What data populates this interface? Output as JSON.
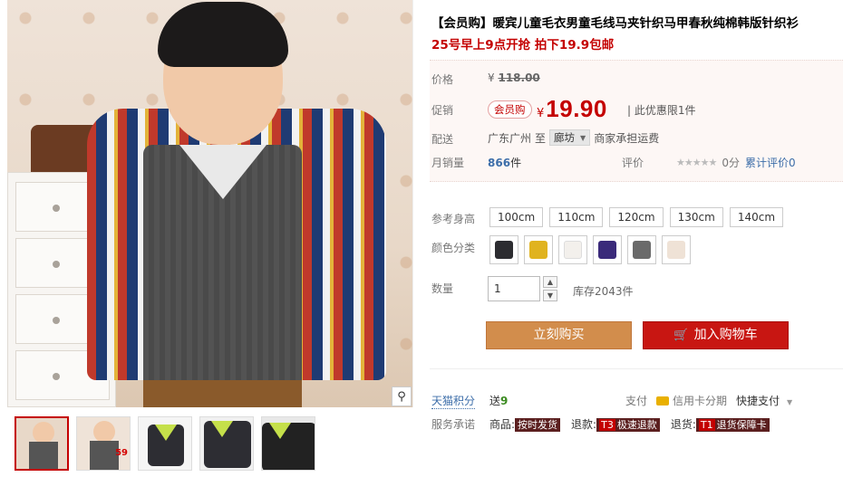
{
  "product": {
    "title": "【会员购】暖宾儿童毛衣男童毛线马夹针织马甲春秋纯棉韩版针织衫",
    "subtitle": "25号早上9点开抢 拍下19.9包邮"
  },
  "price": {
    "label": "价格",
    "currency": "¥",
    "original": "118.00"
  },
  "promo": {
    "label": "促销",
    "badge": "会员购",
    "currency": "¥",
    "value": "19.90",
    "limit": "| 此优惠限1件"
  },
  "delivery": {
    "label": "配送",
    "from": "广东广州",
    "to_word": "至",
    "dest": "廊坊",
    "freight": "商家承担运费"
  },
  "sales": {
    "label": "月销量",
    "count": "866",
    "unit": "件",
    "review_label": "评价",
    "stars": "★★★★★",
    "score": "0分",
    "review_link": "累计评价",
    "review_count": "0"
  },
  "sizes": {
    "label": "参考身高",
    "options": [
      "100cm",
      "110cm",
      "120cm",
      "130cm",
      "140cm"
    ]
  },
  "color": {
    "label": "颜色分类",
    "swatches": [
      "#2c2c30",
      "#e0b31f",
      "#f3f0ec",
      "#3a2a7a",
      "#6a6a6a",
      "#efe2d6"
    ]
  },
  "quantity": {
    "label": "数量",
    "value": "1",
    "stock": "库存2043件"
  },
  "actions": {
    "buy": "立刻购买",
    "cart": "加入购物车"
  },
  "points": {
    "label": "天猫积分",
    "prefix": "送",
    "value": "9"
  },
  "payment": {
    "label": "支付",
    "credit": "信用卡分期",
    "fast": "快捷支付"
  },
  "service": {
    "label": "服务承诺",
    "goods_label": "商品:",
    "goods_tag": "按时发货",
    "refund_label": "退款:",
    "refund_tag": "极速退款",
    "return_label": "退货:",
    "return_tag": "退货保障卡",
    "t3": "T3",
    "t1": "T1"
  },
  "gallery": {
    "thumb_price": "59"
  }
}
